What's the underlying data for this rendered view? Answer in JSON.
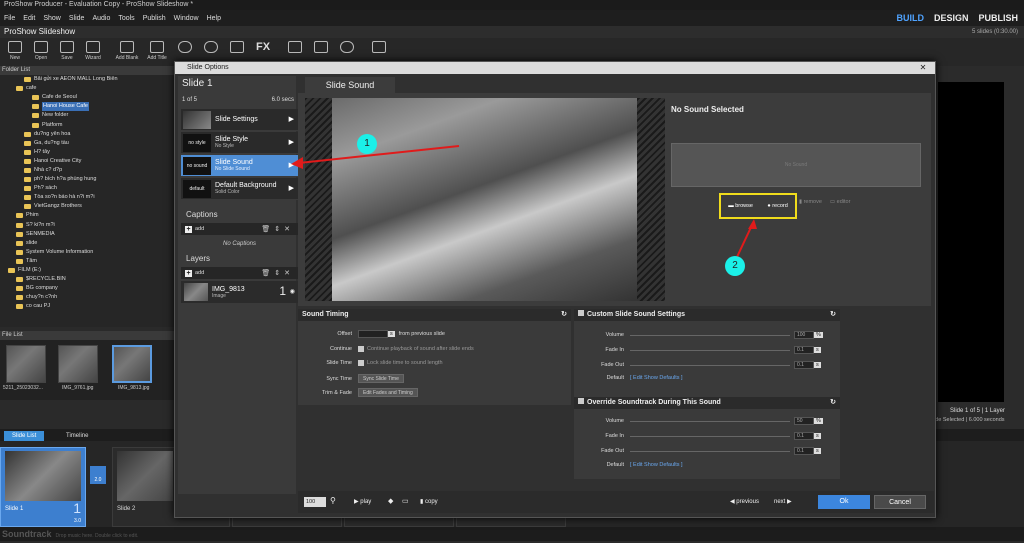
{
  "app": {
    "window_title": "ProShow Producer - Evaluation Copy - ProShow Slideshow *",
    "menu": [
      "File",
      "Edit",
      "Show",
      "Slide",
      "Audio",
      "Tools",
      "Publish",
      "Window",
      "Help"
    ],
    "modes": {
      "build": "BUILD",
      "design": "DESIGN",
      "publish": "PUBLISH"
    },
    "project_title": "ProShow Slideshow",
    "slide_count": "5 slides (0:30.00)"
  },
  "toolbar": {
    "new": "New",
    "open": "Open",
    "save": "Save",
    "wizard": "Wizard",
    "add_blank": "Add Blank",
    "add_title": "Add Title",
    "fx": "FX"
  },
  "folder_list": {
    "header": "Folder List",
    "items": [
      {
        "label": "Bãi gửi xe AEON MALL Long Biên",
        "indent": 2,
        "selected": false
      },
      {
        "label": "cafe",
        "indent": 1,
        "selected": false
      },
      {
        "label": "Cafe de Seoul",
        "indent": 3,
        "selected": false
      },
      {
        "label": "Hanoi House Cafe",
        "indent": 3,
        "selected": true
      },
      {
        "label": "New folder",
        "indent": 3,
        "selected": false
      },
      {
        "label": "Platform",
        "indent": 3,
        "selected": false
      },
      {
        "label": "du?ng yên hoa",
        "indent": 2,
        "selected": false
      },
      {
        "label": "Ga, du?ng tàu",
        "indent": 2,
        "selected": false
      },
      {
        "label": "H? tây",
        "indent": 2,
        "selected": false
      },
      {
        "label": "Hanoi Creative City",
        "indent": 2,
        "selected": false
      },
      {
        "label": "Nhà c? d?p",
        "indent": 2,
        "selected": false
      },
      {
        "label": "ph? bích h?a phùng hung",
        "indent": 2,
        "selected": false
      },
      {
        "label": "Ph? sách",
        "indent": 2,
        "selected": false
      },
      {
        "label": "Tòa so?n báo hà n?i m?i",
        "indent": 2,
        "selected": false
      },
      {
        "label": "VietGangz Brothers",
        "indent": 2,
        "selected": false
      },
      {
        "label": "Phim",
        "indent": 1,
        "selected": false
      },
      {
        "label": "S? ki?n m?i",
        "indent": 1,
        "selected": false
      },
      {
        "label": "SENMEDIA",
        "indent": 1,
        "selected": false
      },
      {
        "label": "slide",
        "indent": 1,
        "selected": false
      },
      {
        "label": "System Volume Information",
        "indent": 1,
        "selected": false
      },
      {
        "label": "Tâm",
        "indent": 1,
        "selected": false
      },
      {
        "label": "FILM (E:)",
        "indent": 0,
        "selected": false
      },
      {
        "label": "$RECYCLE.BIN",
        "indent": 1,
        "selected": false
      },
      {
        "label": "BG company",
        "indent": 1,
        "selected": false
      },
      {
        "label": "chuy?n c?nh",
        "indent": 1,
        "selected": false
      },
      {
        "label": "co cau PJ",
        "indent": 1,
        "selected": false
      }
    ]
  },
  "file_list": {
    "header": "File List",
    "files": [
      "5211_25023032...",
      "IMG_9761.jpg",
      "IMG_9813.jpg"
    ]
  },
  "bottom": {
    "tabs": [
      "Slide List",
      "Timeline"
    ],
    "slide1_label": "Slide 1",
    "slide1_number": "1",
    "slide1_time": "3.0",
    "slide2_label": "Slide 2",
    "transition": "2.0",
    "soundtrack": "Soundtrack",
    "soundtrack_hint": "Drop music here. Double click to edit."
  },
  "preview": {
    "slide_info": "Slide 1 of 5  |  1 Layer",
    "selected_info": "ide Selected  |  6.000 seconds"
  },
  "dialog": {
    "title": "Slide Options",
    "close": "✕",
    "slide_name": "Slide 1",
    "position": "1 of 5",
    "duration": "6.0 secs",
    "menu": [
      {
        "icon": "",
        "title": "Slide Settings",
        "sub": ""
      },
      {
        "icon": "no style",
        "title": "Slide Style",
        "sub": "No Style"
      },
      {
        "icon": "no sound",
        "title": "Slide Sound",
        "sub": "No Slide Sound"
      },
      {
        "icon": "default",
        "title": "Default Background",
        "sub": "Solid Color"
      }
    ],
    "captions_title": "Captions",
    "add_label": "add",
    "no_captions": "No Captions",
    "layers_title": "Layers",
    "layer": {
      "name": "IMG_9813",
      "type": "Image",
      "number": "1"
    },
    "tab": "Slide Sound",
    "no_sound_selected": "No Sound Selected",
    "no_sound_box": "No Sound",
    "sound_buttons": {
      "browse": "browse",
      "record": "record",
      "remove": "remove",
      "editor": "editor"
    },
    "callouts": [
      "1",
      "2"
    ],
    "sound_timing": {
      "title": "Sound Timing",
      "offset_label": "Offset",
      "offset_unit": "s",
      "offset_suffix": "from previous slide",
      "continue_label": "Continue",
      "continue_text": "Continue playback of sound after slide ends",
      "slidetime_label": "Slide Time",
      "slidetime_text": "Lock slide time to sound length",
      "sync_label": "Sync Time",
      "sync_btn": "Sync Slide Time",
      "trim_label": "Trim & Fade",
      "trim_btn": "Edit Fades and Timing"
    },
    "custom_sound": {
      "title": "Custom Slide Sound Settings",
      "volume_label": "Volume",
      "volume": "100",
      "volume_unit": "%",
      "fadein_label": "Fade In",
      "fadein": "0.1",
      "fadein_unit": "s",
      "fadeout_label": "Fade Out",
      "fadeout": "0.1",
      "fadeout_unit": "s",
      "default_label": "Default",
      "default_link": "[ Edit Show Defaults ]"
    },
    "override": {
      "title": "Override Soundtrack During This Sound",
      "volume_label": "Volume",
      "volume": "50",
      "volume_unit": "%",
      "fadein_label": "Fade In",
      "fadein": "0.1",
      "fadein_unit": "s",
      "fadeout_label": "Fade Out",
      "fadeout": "0.1",
      "fadeout_unit": "s",
      "default_label": "Default",
      "default_link": "[ Edit Show Defaults ]"
    },
    "bottom": {
      "zoom": "100",
      "play": "play",
      "copy": "copy",
      "previous": "previous",
      "next": "next",
      "ok": "Ok",
      "cancel": "Cancel"
    }
  }
}
